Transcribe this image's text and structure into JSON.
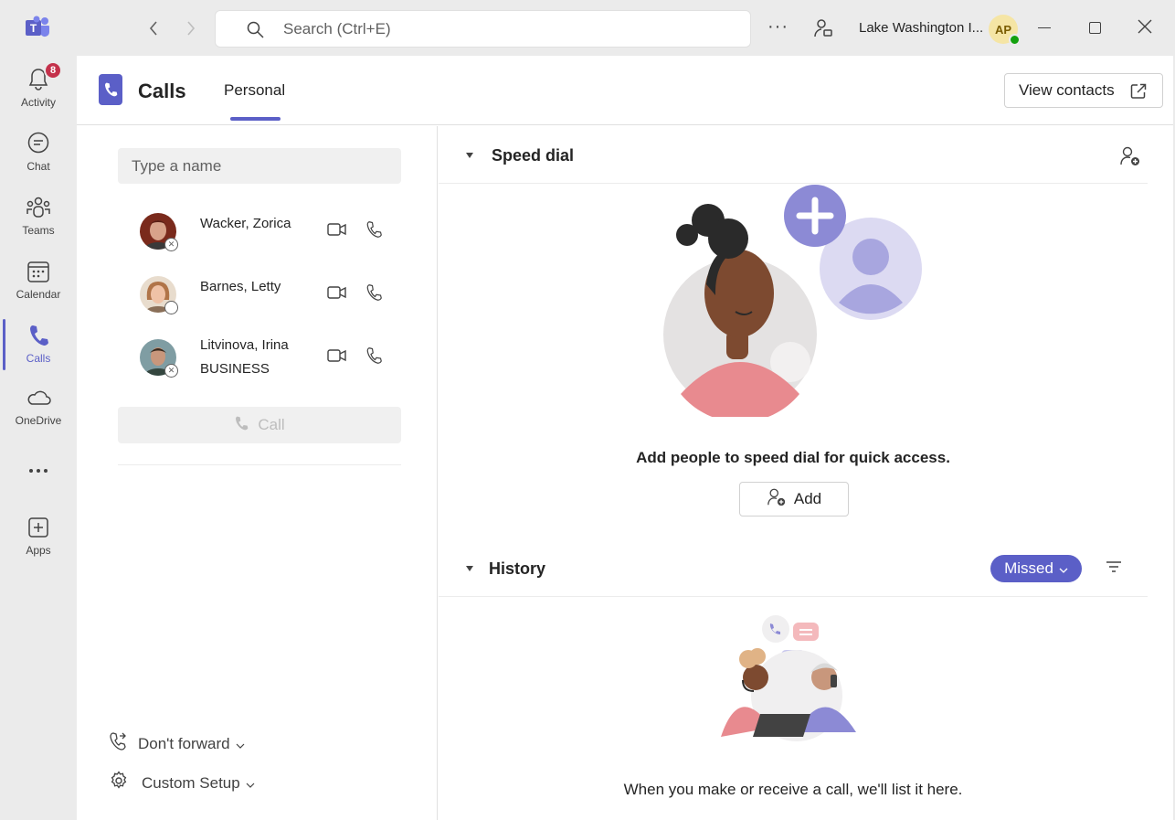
{
  "titlebar": {
    "search_placeholder": "Search (Ctrl+E)",
    "org_name": "Lake Washington I...",
    "avatar_initials": "AP"
  },
  "rail": {
    "items": [
      {
        "label": "Activity",
        "icon": "bell-icon",
        "badge": "8"
      },
      {
        "label": "Chat",
        "icon": "chat-icon"
      },
      {
        "label": "Teams",
        "icon": "teams-icon"
      },
      {
        "label": "Calendar",
        "icon": "calendar-icon"
      },
      {
        "label": "Calls",
        "icon": "phone-icon",
        "active": true
      },
      {
        "label": "OneDrive",
        "icon": "cloud-icon"
      },
      {
        "label": "...",
        "icon": "more-icon"
      },
      {
        "label": "Apps",
        "icon": "plus-square-icon"
      }
    ]
  },
  "header": {
    "title": "Calls",
    "tab": "Personal",
    "view_contacts": "View contacts"
  },
  "dialer": {
    "input_placeholder": "Type a name",
    "contacts": [
      {
        "name": "Wacker, Zorica",
        "sub": ""
      },
      {
        "name": "Barnes, Letty",
        "sub": ""
      },
      {
        "name": "Litvinova, Irina",
        "sub": "BUSINESS"
      }
    ],
    "call_label": "Call",
    "forward_label": "Don't forward",
    "setup_label": "Custom Setup"
  },
  "speed_dial": {
    "title": "Speed dial",
    "message": "Add people to speed dial for quick access.",
    "add_label": "Add"
  },
  "history": {
    "title": "History",
    "filter_label": "Missed",
    "message": "When you make or receive a call, we'll list it here."
  },
  "colors": {
    "accent": "#5b5fc7",
    "badge": "#c4314b",
    "presence_available": "#13a10e"
  }
}
